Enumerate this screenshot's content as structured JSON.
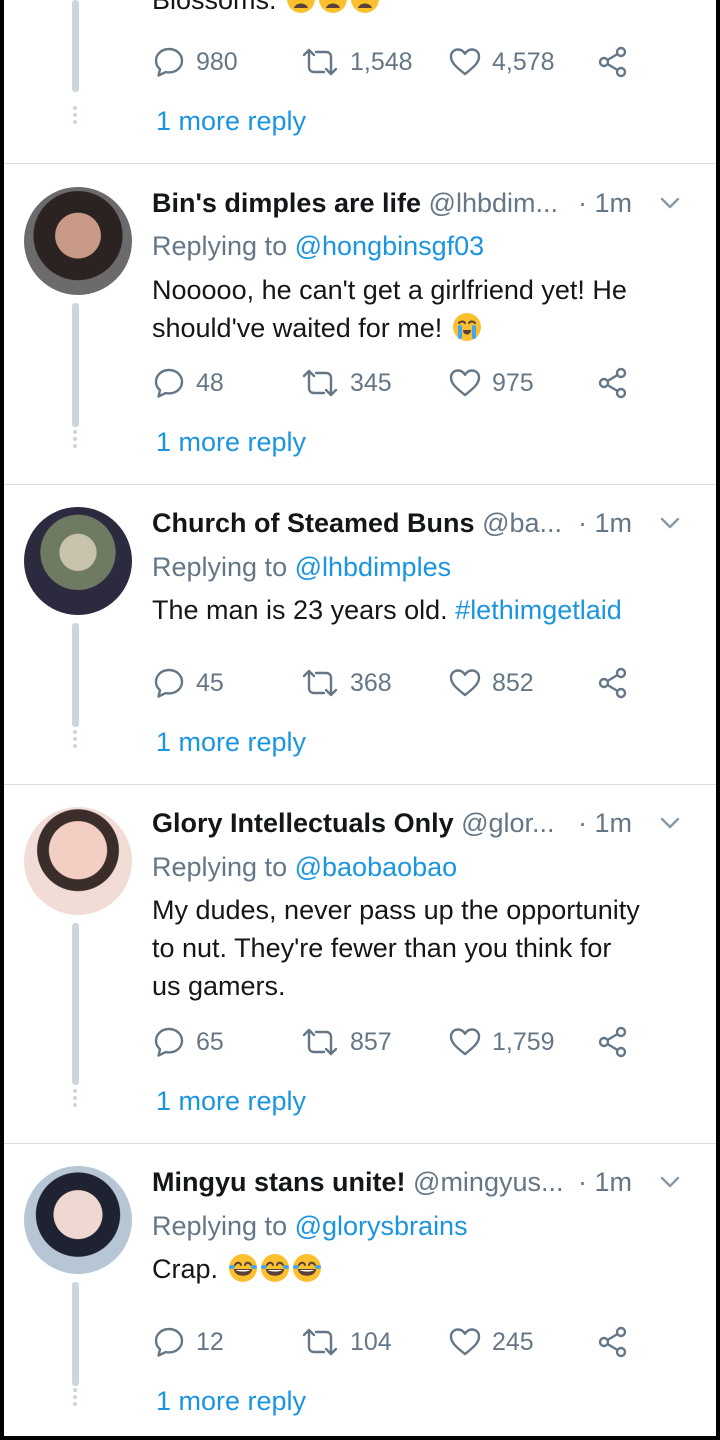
{
  "top_tweet": {
    "text_fragment": "Blossoms.",
    "stats": {
      "replies": "980",
      "retweets": "1,548",
      "likes": "4,578"
    },
    "more_reply": "1 more reply"
  },
  "tweets": [
    {
      "name": "Bin's dimples are life",
      "handle": "@lhbdim...",
      "time": "· 1m",
      "replying_prefix": "Replying to",
      "replying_to": "@hongbinsgf03",
      "text_1": "Nooooo, he can't get a girlfriend yet!  He",
      "text_2": "should've waited for me!",
      "stats": {
        "replies": "48",
        "retweets": "345",
        "likes": "975"
      },
      "more_reply": "1 more reply"
    },
    {
      "name": "Church of Steamed Buns",
      "handle": "@ba...",
      "time": "· 1m",
      "replying_prefix": "Replying to",
      "replying_to": "@lhbdimples",
      "text_1": "The man is 23 years old.",
      "hashtag": "#lethimgetlaid",
      "stats": {
        "replies": "45",
        "retweets": "368",
        "likes": "852"
      },
      "more_reply": "1 more reply"
    },
    {
      "name": "Glory Intellectuals Only",
      "handle": "@glor...",
      "time": "· 1m",
      "replying_prefix": "Replying to",
      "replying_to": "@baobaobao",
      "text_1": "My dudes, never pass up the opportunity",
      "text_2": "to nut. They're fewer than you think for",
      "text_3": "us gamers.",
      "stats": {
        "replies": "65",
        "retweets": "857",
        "likes": "1,759"
      },
      "more_reply": "1 more reply"
    },
    {
      "name": "Mingyu stans unite!",
      "handle": "@mingyus...",
      "time": "· 1m",
      "replying_prefix": "Replying to",
      "replying_to": "@glorysbrains",
      "text_1": "Crap.",
      "stats": {
        "replies": "12",
        "retweets": "104",
        "likes": "245"
      },
      "more_reply": "1 more reply"
    }
  ],
  "colors": {
    "link": "#1b95e0",
    "muted": "#657786",
    "text": "#14171a",
    "divider": "#d8dee3"
  },
  "icons": [
    "reply-icon",
    "retweet-icon",
    "like-icon",
    "share-icon",
    "chevron-down-icon",
    "emoji-weary",
    "emoji-crying",
    "emoji-tears-of-joy"
  ]
}
